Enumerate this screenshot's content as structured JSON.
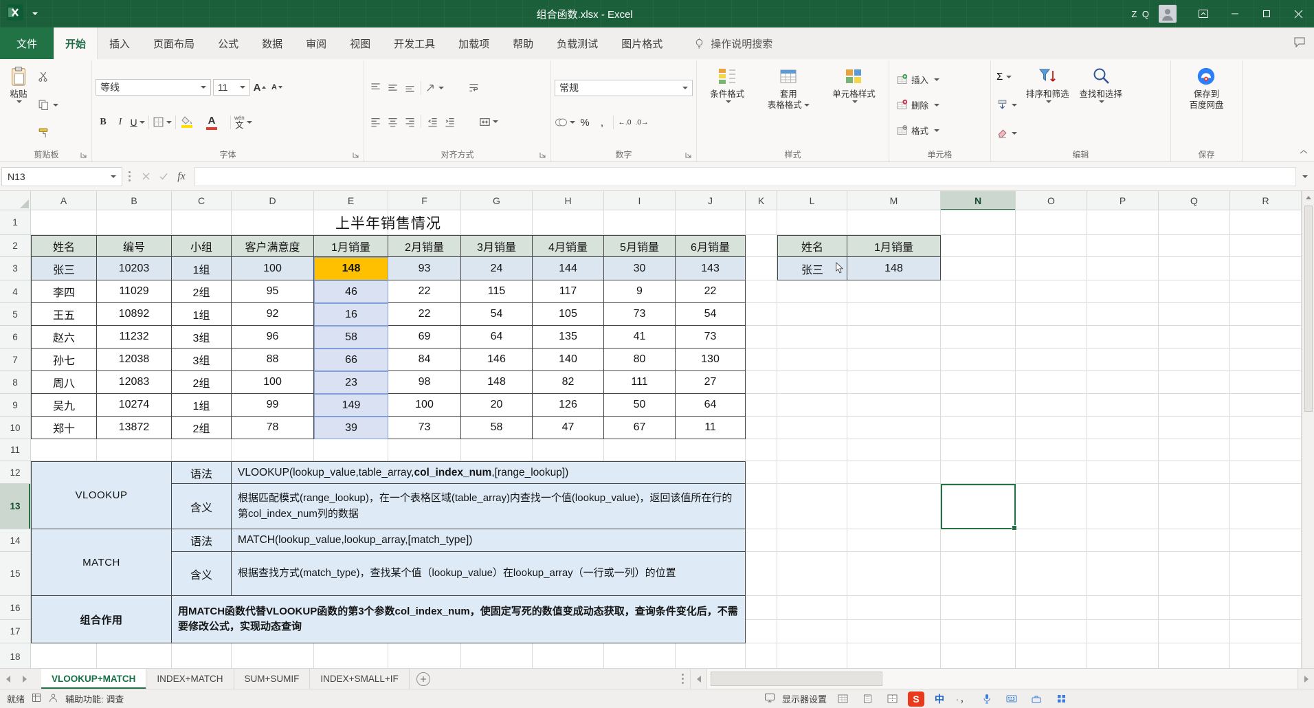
{
  "titlebar": {
    "title": "组合函数.xlsx - Excel",
    "user": "Z Q"
  },
  "menu": {
    "file": "文件",
    "tabs": [
      "开始",
      "插入",
      "页面布局",
      "公式",
      "数据",
      "审阅",
      "视图",
      "开发工具",
      "加载项",
      "帮助",
      "负载测试",
      "图片格式"
    ],
    "active_tab": "开始",
    "search": "操作说明搜索"
  },
  "ribbon": {
    "clipboard": {
      "paste": "粘贴",
      "group": "剪贴板"
    },
    "font": {
      "name": "等线",
      "size": "11",
      "bold": "B",
      "italic": "I",
      "underline": "U",
      "grow_letter": "A",
      "shrink_letter": "A",
      "color_letter": "A",
      "phonetic_top": "wén",
      "phonetic_bottom": "文",
      "group": "字体"
    },
    "alignment": {
      "group": "对齐方式"
    },
    "number": {
      "format": "常规",
      "percent": "%",
      "comma": ",",
      "inc_decimal": "←.0",
      "dec_decimal": ".0→",
      "group": "数字"
    },
    "styles": {
      "conditional": "条件格式",
      "table_line1": "套用",
      "table_line2": "表格格式",
      "cell_styles": "单元格样式",
      "group": "样式"
    },
    "cells": {
      "insert": "插入",
      "delete": "删除",
      "format": "格式",
      "group": "单元格"
    },
    "editing": {
      "sigma": "Σ",
      "sort": "排序和筛选",
      "find": "查找和选择",
      "group": "编辑"
    },
    "save": {
      "line1": "保存到",
      "line2": "百度网盘",
      "group": "保存"
    }
  },
  "formula_bar": {
    "name_box": "N13",
    "fx": "fx",
    "formula": ""
  },
  "grid": {
    "col_letters": [
      "A",
      "B",
      "C",
      "D",
      "E",
      "F",
      "G",
      "H",
      "I",
      "J",
      "K",
      "L",
      "M",
      "N",
      "O",
      "P",
      "Q",
      "R"
    ],
    "row_count": 18,
    "selected_col": "N",
    "selected_row": 13,
    "selected_ref": "N13"
  },
  "sheet": {
    "title": "上半年销售情况",
    "main_table": {
      "headers": [
        "姓名",
        "编号",
        "小组",
        "客户满意度",
        "1月销量",
        "2月销量",
        "3月销量",
        "4月销量",
        "5月销量",
        "6月销量"
      ],
      "rows": [
        [
          "张三",
          "10203",
          "1组",
          "100",
          "148",
          "93",
          "24",
          "144",
          "30",
          "143"
        ],
        [
          "李四",
          "11029",
          "2组",
          "95",
          "46",
          "22",
          "115",
          "117",
          "9",
          "22"
        ],
        [
          "王五",
          "10892",
          "1组",
          "92",
          "16",
          "22",
          "54",
          "105",
          "73",
          "54"
        ],
        [
          "赵六",
          "11232",
          "3组",
          "96",
          "58",
          "69",
          "64",
          "135",
          "41",
          "73"
        ],
        [
          "孙七",
          "12038",
          "3组",
          "88",
          "66",
          "84",
          "146",
          "140",
          "80",
          "130"
        ],
        [
          "周八",
          "12083",
          "2组",
          "100",
          "23",
          "98",
          "148",
          "82",
          "111",
          "27"
        ],
        [
          "吴九",
          "10274",
          "1组",
          "99",
          "149",
          "100",
          "20",
          "126",
          "50",
          "64"
        ],
        [
          "郑十",
          "13872",
          "2组",
          "78",
          "39",
          "73",
          "58",
          "47",
          "67",
          "11"
        ]
      ]
    },
    "lookup_table": {
      "headers": [
        "姓名",
        "1月销量"
      ],
      "values": [
        "张三",
        "148"
      ]
    },
    "info": {
      "syntax_label": "语法",
      "meaning_label": "含义",
      "vlookup": {
        "name": "VLOOKUP",
        "syntax_pre": "VLOOKUP(lookup_value,table_array,",
        "syntax_bold": "col_index_num",
        "syntax_post": ",[range_lookup])",
        "meaning": "根据匹配模式(range_lookup)，在一个表格区域(table_array)内查找一个值(lookup_value)，返回该值所在行的第col_index_num列的数据"
      },
      "match": {
        "name": "MATCH",
        "syntax": "MATCH(lookup_value,lookup_array,[match_type])",
        "meaning": "根据查找方式(match_type)，查找某个值（lookup_value）在lookup_array（一行或一列）的位置"
      },
      "combo": {
        "name": "组合作用",
        "text": "用MATCH函数代替VLOOKUP函数的第3个参数col_index_num，使固定写死的数值变成动态获取，查询条件变化后，不需要修改公式，实现动态查询"
      }
    }
  },
  "sheet_tabs": {
    "tabs": [
      "VLOOKUP+MATCH",
      "INDEX+MATCH",
      "SUM+SUMIF",
      "INDEX+SMALL+IF"
    ],
    "active": "VLOOKUP+MATCH"
  },
  "status_bar": {
    "ready": "就绪",
    "accessibility": "辅助功能: 调查",
    "display": "显示器设置",
    "ime_logo": "S",
    "ime_cn": "中",
    "ime_punct": "·，"
  },
  "colors": {
    "accent_green": "#217346",
    "titlebar_green": "#1B5E3A",
    "header_fill": "#D7E2DB",
    "row_blue": "#DCE6F1",
    "col_lavender": "#D9E1F2",
    "lavender_border": "#7F9ED7",
    "highlight_orange": "#FFC000",
    "info_fill": "#DEEBF7"
  }
}
